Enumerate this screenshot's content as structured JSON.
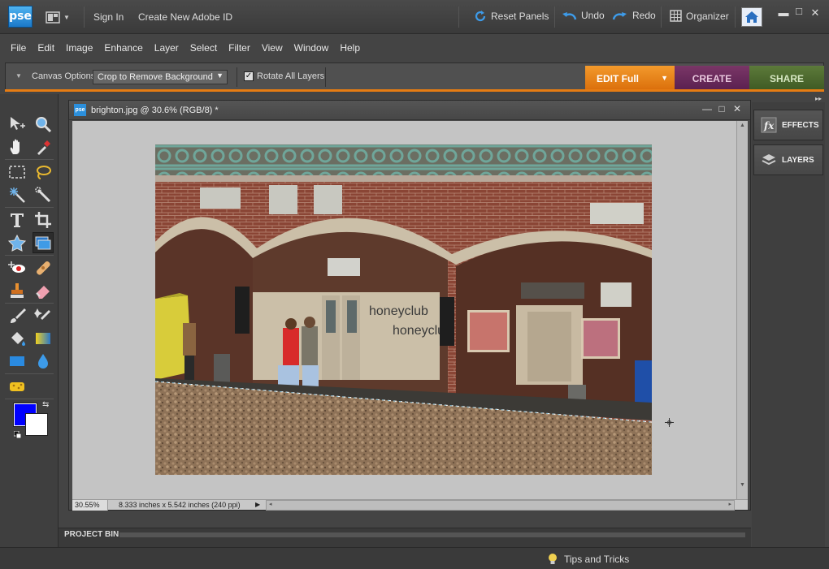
{
  "titlebar": {
    "logo": "pse",
    "sign_in": "Sign In",
    "create_id": "Create New Adobe ID",
    "reset_panels": "Reset Panels",
    "undo": "Undo",
    "redo": "Redo",
    "organizer": "Organizer",
    "minimize": "▬",
    "maximize": "□",
    "close": "✕"
  },
  "menu": [
    "File",
    "Edit",
    "Image",
    "Enhance",
    "Layer",
    "Select",
    "Filter",
    "View",
    "Window",
    "Help"
  ],
  "options": {
    "label": "Canvas Options:",
    "canvas_value": "Crop to Remove Background",
    "rotate_label": "Rotate All Layers",
    "rotate_checked": "✓"
  },
  "modes": {
    "edit": "EDIT Full",
    "create": "CREATE",
    "share": "SHARE"
  },
  "document": {
    "icon": "pse",
    "title": "brighton.jpg @ 30.6% (RGB/8) *",
    "zoom": "30.55%",
    "info": "8.333 inches x 5.542 inches (240 ppi)"
  },
  "panels": {
    "effects": "EFFECTS",
    "layers": "LAYERS"
  },
  "project_bin": "PROJECT BIN",
  "tips": "Tips and Tricks",
  "photo": {
    "sign1": "honeyclub",
    "sign2": "honeyclub"
  },
  "colors": {
    "foreground": "#0000ff",
    "background": "#ffffff",
    "accent": "#e67c13"
  }
}
